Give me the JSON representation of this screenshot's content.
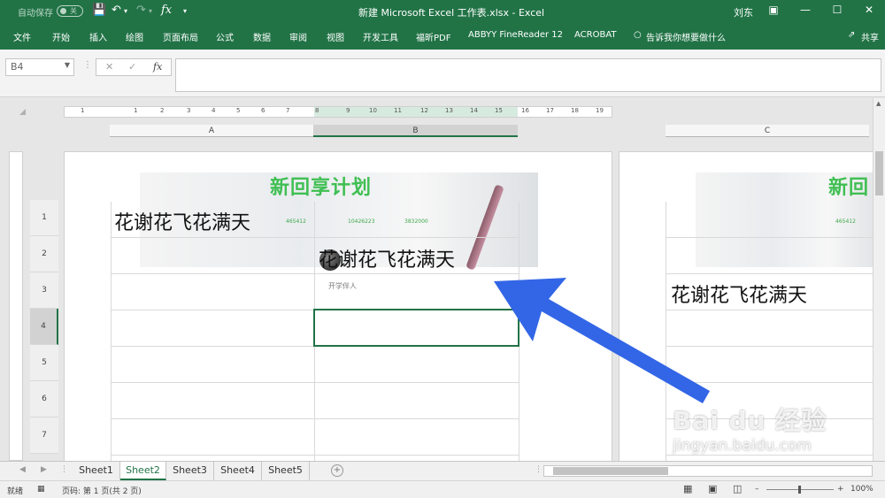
{
  "titlebar": {
    "autosave": "自动保存",
    "autosave_state": "关",
    "title": "新建 Microsoft Excel 工作表.xlsx  -  Excel",
    "user": "刘东"
  },
  "ribbon": {
    "tabs": [
      "文件",
      "开始",
      "插入",
      "绘图",
      "页面布局",
      "公式",
      "数据",
      "审阅",
      "视图",
      "开发工具",
      "福昕PDF",
      "ABBYY FineReader 12",
      "ACROBAT",
      "告诉我你想要做什么"
    ],
    "share": "共享"
  },
  "formula_bar": {
    "name_box": "B4",
    "fx": "fx",
    "value": ""
  },
  "ruler": {
    "numbers": [
      "1",
      "1",
      "2",
      "3",
      "4",
      "5",
      "6",
      "7",
      "8",
      "9",
      "10",
      "11",
      "12",
      "13",
      "14",
      "15",
      "16",
      "17",
      "18",
      "19"
    ]
  },
  "columns": [
    "A",
    "B",
    "C"
  ],
  "rows": [
    "1",
    "2",
    "3",
    "4",
    "5",
    "6",
    "7"
  ],
  "page1": {
    "banner_title": "新回享计划",
    "stats": [
      "465412",
      "10426223",
      "3832000"
    ],
    "cell_a1": "花谢花飞花满天",
    "cell_b2": "花谢花飞花满天",
    "caption": "开学伴人"
  },
  "page2": {
    "banner_title": "新回",
    "stat": "465412",
    "cell_c3": "花谢花飞花满天"
  },
  "sheets": {
    "tabs": [
      "Sheet1",
      "Sheet2",
      "Sheet3",
      "Sheet4",
      "Sheet5"
    ],
    "active": "Sheet2"
  },
  "statusbar": {
    "mode": "就绪",
    "page_info": "页码: 第 1 页(共 2 页)",
    "zoom": "100%"
  },
  "watermark": {
    "logo": "Bai du 经验",
    "site": "jingyan.baidu.com"
  },
  "colors": {
    "excel_green": "#217346",
    "annotation_arrow": "#3366e6"
  }
}
